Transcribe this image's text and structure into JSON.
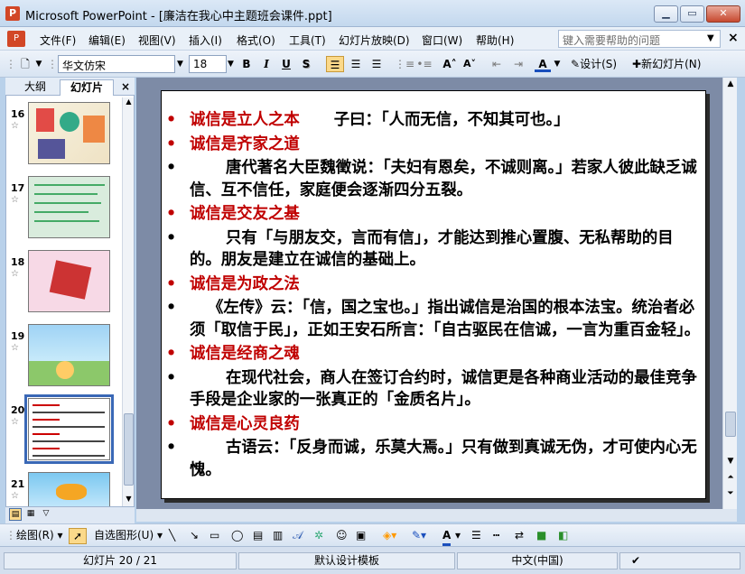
{
  "window": {
    "title": "Microsoft PowerPoint - [廉洁在我心中主题班会课件.ppt]",
    "app_icon": "powerpoint-icon",
    "controls": [
      "minimize-icon",
      "maximize-icon",
      "close-icon"
    ]
  },
  "menu": {
    "items": [
      "文件(F)",
      "编辑(E)",
      "视图(V)",
      "插入(I)",
      "格式(O)",
      "工具(T)",
      "幻灯片放映(D)",
      "窗口(W)",
      "帮助(H)"
    ],
    "help_placeholder": "键入需要帮助的问题"
  },
  "toolbar": {
    "font_name": "华文仿宋",
    "font_size": "18",
    "bold": "B",
    "italic": "I",
    "underline": "U",
    "shadow": "S",
    "design_label": "设计(S)",
    "new_slide_label": "新幻灯片(N)"
  },
  "panel": {
    "tabs": [
      "大纲",
      "幻灯片"
    ],
    "active_tab": "幻灯片",
    "slides": [
      {
        "num": "16"
      },
      {
        "num": "17"
      },
      {
        "num": "18"
      },
      {
        "num": "19"
      },
      {
        "num": "20"
      },
      {
        "num": "21"
      }
    ],
    "selected_slide": "20"
  },
  "slide": {
    "lines": [
      {
        "type": "heading",
        "text": "诚信是立人之本",
        "extra": "子曰：「人而无信，不知其可也。」"
      },
      {
        "type": "heading",
        "text": "诚信是齐家之道"
      },
      {
        "type": "body",
        "text": "唐代著名大臣魏徵说：「夫妇有恩矣，不诚则离。」若家人彼此缺乏诚信、互不信任，家庭便会逐渐四分五裂。"
      },
      {
        "type": "heading",
        "text": "诚信是交友之基"
      },
      {
        "type": "body",
        "text": "只有「与朋友交，言而有信」，才能达到推心置腹、无私帮助的目的。朋友是建立在诚信的基础上。"
      },
      {
        "type": "heading",
        "text": "诚信是为政之法"
      },
      {
        "type": "body",
        "text": "《左传》云：「信，国之宝也。」指出诚信是治国的根本法宝。统治者必须「取信于民」，正如王安石所言：「自古驱民在信诚，一言为重百金轻」。"
      },
      {
        "type": "heading",
        "text": "诚信是经商之魂"
      },
      {
        "type": "body",
        "text": "在现代社会，商人在签订合约时，诚信更是各种商业活动的最佳竞争手段是企业家的一张真正的「金质名片」。"
      },
      {
        "type": "heading",
        "text": "诚信是心灵良药"
      },
      {
        "type": "body",
        "text": "古语云：「反身而诚，乐莫大焉。」只有做到真诚无伪，才可使内心无愧。"
      }
    ]
  },
  "drawbar": {
    "draw_label": "绘图(R)",
    "autoshapes_label": "自选图形(U)"
  },
  "status": {
    "slide_pos": "幻灯片 20 / 21",
    "template": "默认设计模板",
    "language": "中文(中国)"
  },
  "colors": {
    "heading": "#c00000",
    "canvas": "#7d8ba6"
  }
}
